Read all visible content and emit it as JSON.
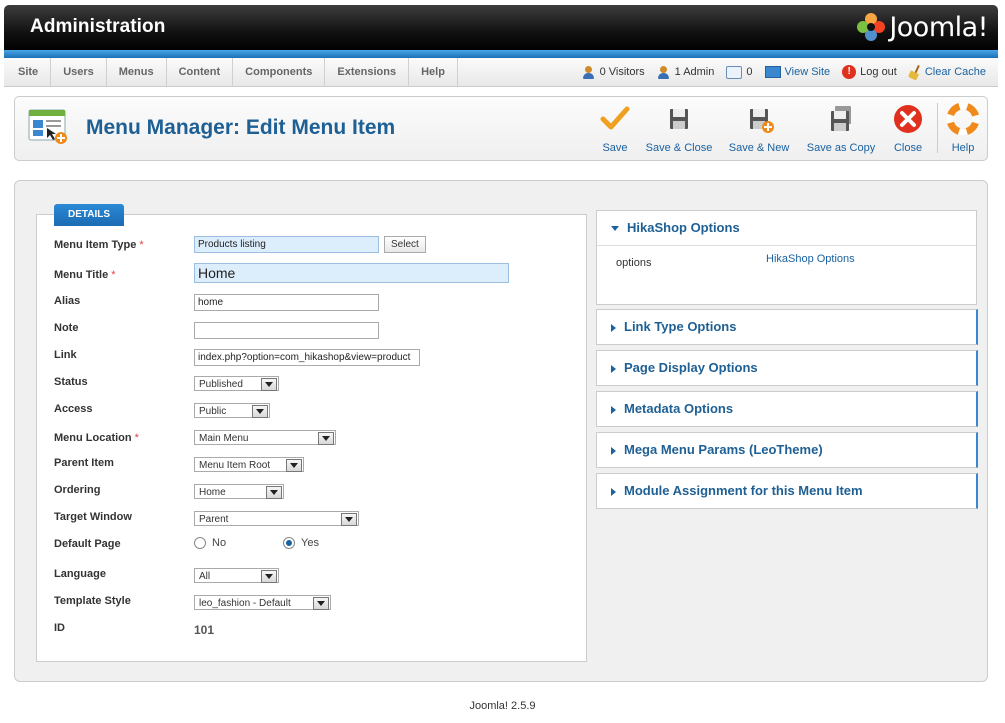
{
  "header": {
    "title": "Administration",
    "brand": "Joomla!"
  },
  "menubar": {
    "items": [
      "Site",
      "Users",
      "Menus",
      "Content",
      "Components",
      "Extensions",
      "Help"
    ],
    "status": {
      "visitors": "0 Visitors",
      "admins": "1 Admin",
      "messages": "0",
      "view_site": "View Site",
      "logout": "Log out",
      "clear_cache": "Clear Cache"
    }
  },
  "toolbar": {
    "page_title": "Menu Manager: Edit Menu Item",
    "buttons": {
      "save": "Save",
      "save_close": "Save & Close",
      "save_new": "Save & New",
      "save_copy": "Save as Copy",
      "close": "Close",
      "help": "Help"
    }
  },
  "details": {
    "tab_label": "DETAILS",
    "labels": {
      "menu_item_type": "Menu Item Type",
      "menu_title": "Menu Title",
      "alias": "Alias",
      "note": "Note",
      "link": "Link",
      "status": "Status",
      "access": "Access",
      "menu_location": "Menu Location",
      "parent_item": "Parent Item",
      "ordering": "Ordering",
      "target_window": "Target Window",
      "default_page": "Default Page",
      "language": "Language",
      "template_style": "Template Style",
      "id": "ID"
    },
    "required_mark": "*",
    "values": {
      "menu_item_type": "Products listing",
      "select_button": "Select",
      "menu_title": "Home",
      "alias": "home",
      "note": "",
      "link": "index.php?option=com_hikashop&view=product",
      "status": "Published",
      "access": "Public",
      "menu_location": "Main Menu",
      "parent_item": "Menu Item Root",
      "ordering": "Home",
      "target_window": "Parent",
      "default_no": "No",
      "default_yes": "Yes",
      "language": "All",
      "template_style": "leo_fashion - Default",
      "id": "101"
    }
  },
  "panels": {
    "hikashop": {
      "title": "HikaShop Options",
      "field_label": "options",
      "field_value": "HikaShop Options"
    },
    "link_type": "Link Type Options",
    "page_display": "Page Display Options",
    "metadata": "Metadata Options",
    "mega_menu": "Mega Menu Params (LeoTheme)",
    "module_assignment": "Module Assignment for this Menu Item"
  },
  "footer": {
    "version": "Joomla! 2.5.9"
  }
}
